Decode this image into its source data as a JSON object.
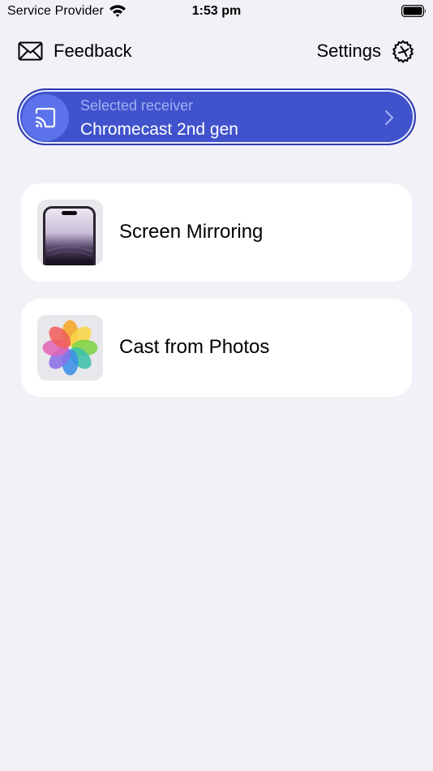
{
  "status_bar": {
    "carrier": "Service Provider",
    "time": "1:53 pm"
  },
  "nav": {
    "feedback_label": "Feedback",
    "settings_label": "Settings"
  },
  "receiver": {
    "caption": "Selected receiver",
    "name": "Chromecast 2nd gen"
  },
  "options": [
    {
      "label": "Screen Mirroring",
      "icon": "phone-icon"
    },
    {
      "label": "Cast from Photos",
      "icon": "photos-icon"
    }
  ],
  "colors": {
    "background": "#f2f1f7",
    "accent": "#4052cc",
    "accent_light": "#5b72ea",
    "caption": "#9fb0f1"
  }
}
